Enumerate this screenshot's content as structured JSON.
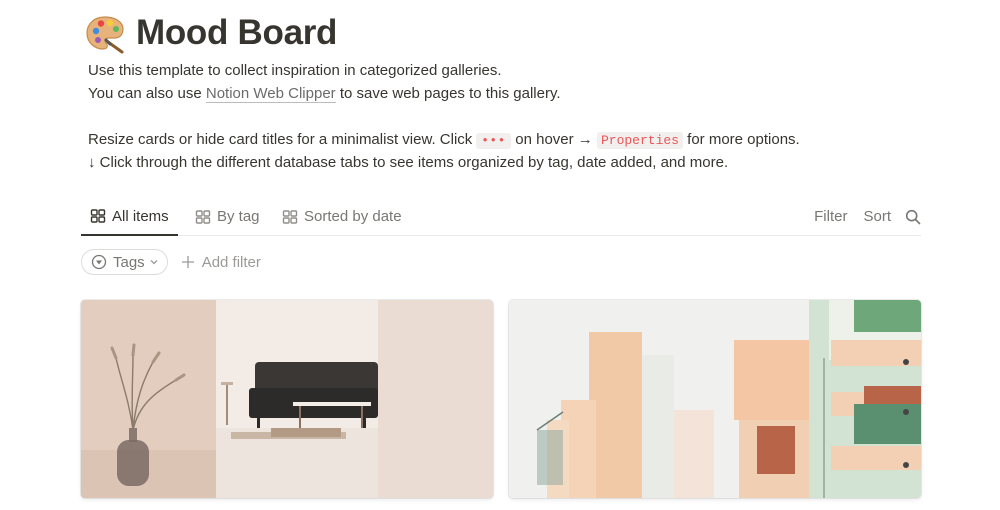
{
  "page": {
    "emoji_icon": "artist-palette-icon",
    "title": "Mood Board"
  },
  "description": {
    "line1": "Use this template to collect inspiration in categorized galleries.",
    "line2_prefix": "You can also use ",
    "line2_link": "Notion Web Clipper",
    "line2_suffix": " to save web pages to this gallery.",
    "line3_prefix": "Resize cards or hide card titles for a minimalist view. Click ",
    "line3_dots": "•••",
    "line3_middle": " on hover → ",
    "line3_code": "Properties",
    "line3_suffix": " for more options.",
    "line4": "↓ Click through the different database tabs to see items organized by tag, date added, and more."
  },
  "views": {
    "tabs": [
      {
        "label": "All items",
        "icon": "gallery-icon",
        "active": true
      },
      {
        "label": "By tag",
        "icon": "gallery-icon",
        "active": false
      },
      {
        "label": "Sorted by date",
        "icon": "gallery-icon",
        "active": false
      }
    ],
    "filter_label": "Filter",
    "sort_label": "Sort",
    "search_icon": "search-icon"
  },
  "filters": {
    "tags_label": "Tags",
    "add_filter_label": "Add filter"
  },
  "gallery": {
    "cards": [
      {
        "cover": "living-room-sofa-photo"
      },
      {
        "cover": "pastel-building-balconies-photo"
      }
    ]
  },
  "colors": {
    "text": "#37352f",
    "muted": "#787774",
    "code_red": "#eb5757",
    "divider": "#e9e9e7"
  }
}
